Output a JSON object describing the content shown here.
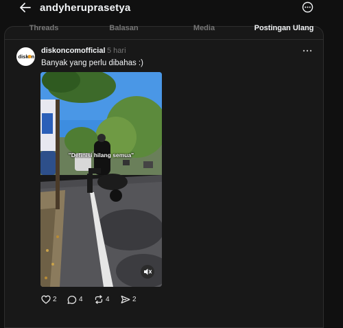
{
  "header": {
    "username": "andyheruprasetya"
  },
  "tabs": [
    {
      "label": "Threads",
      "active": false
    },
    {
      "label": "Balasan",
      "active": false
    },
    {
      "label": "Media",
      "active": false
    },
    {
      "label": "Postingan Ulang",
      "active": true
    }
  ],
  "post": {
    "author": "diskoncomofficial",
    "time": "5 hari",
    "text": "Banyak yang perlu dibahas :)",
    "avatar_text_left": "disk",
    "avatar_text_right": "n",
    "video": {
      "caption": "\"Definisi hilang semua\"",
      "muted": true
    },
    "actions": {
      "likes": "2",
      "replies": "4",
      "reposts": "4",
      "shares": "2"
    }
  },
  "colors": {
    "background": "#101010",
    "panel": "#181818",
    "border": "#2e2e2e",
    "text": "#f3f5f7",
    "muted_text": "#777777"
  }
}
